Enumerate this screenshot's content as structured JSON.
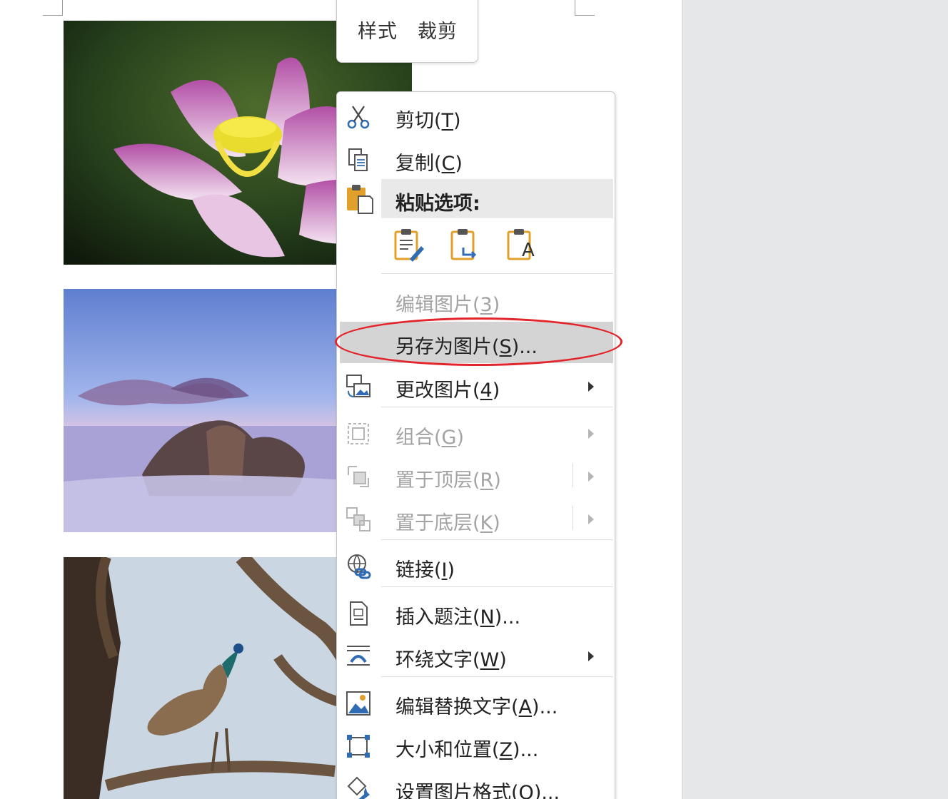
{
  "mini_toolbar": {
    "style": "样式",
    "crop": "裁剪"
  },
  "context_menu": {
    "cut": "剪切(T)",
    "copy": "复制(C)",
    "paste_options": "粘贴选项:",
    "paste_text_glyph": "A",
    "edit_picture": "编辑图片(3)",
    "save_as_picture": "另存为图片(S)...",
    "change_picture": "更改图片(4)",
    "group": "组合(G)",
    "bring_to_front": "置于顶层(R)",
    "send_to_back": "置于底层(K)",
    "link": "链接(I)",
    "insert_caption": "插入题注(N)...",
    "wrap_text": "环绕文字(W)",
    "edit_alt_text": "编辑替换文字(A)...",
    "size_position": "大小和位置(Z)...",
    "format_picture": "设置图片格式(O)..."
  },
  "colors": {
    "highlight": "#d4d4d4",
    "annotation_red": "#e3242b",
    "icon_blue": "#2f6cb3",
    "icon_gold": "#e0a02a"
  }
}
